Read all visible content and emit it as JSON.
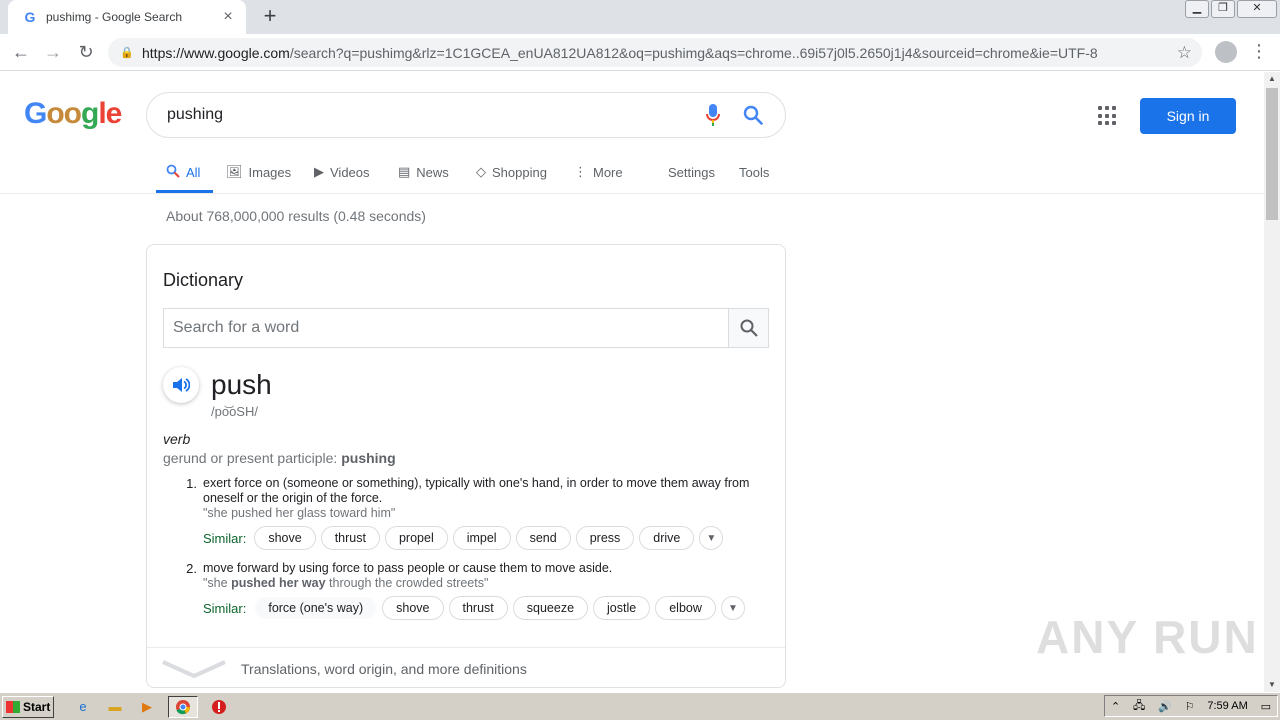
{
  "browser": {
    "tab_title": "pushimg - Google Search",
    "url_host": "https://www.google.com",
    "url_rest": "/search?q=pushimg&rlz=1C1GCEA_enUA812UA812&oq=pushimg&aqs=chrome..69i57j0l5.2650j1j4&sourceid=chrome&ie=UTF-8"
  },
  "search": {
    "query": "pushing"
  },
  "header": {
    "sign_in": "Sign in"
  },
  "tabs": [
    {
      "label": "All"
    },
    {
      "label": "Images"
    },
    {
      "label": "Videos"
    },
    {
      "label": "News"
    },
    {
      "label": "Shopping"
    },
    {
      "label": "More"
    },
    {
      "label": "Settings"
    },
    {
      "label": "Tools"
    }
  ],
  "stats": "About 768,000,000 results (0.48 seconds)",
  "dictionary": {
    "heading": "Dictionary",
    "search_placeholder": "Search for a word",
    "word": "push",
    "phonetic": "/po͝oSH/",
    "part_of_speech": "verb",
    "gerund_label": "gerund or present participle: ",
    "gerund_value": "pushing",
    "similar_label": "Similar:",
    "definitions": [
      {
        "num": "1.",
        "text": "exert force on (someone or something), typically with one's hand, in order to move them away from oneself or the origin of the force.",
        "example": "\"she pushed her glass toward him\"",
        "similar": [
          "shove",
          "thrust",
          "propel",
          "impel",
          "send",
          "press",
          "drive"
        ]
      },
      {
        "num": "2.",
        "text": "move forward by using force to pass people or cause them to move aside.",
        "example_pre": "\"she ",
        "example_bold": "pushed her way",
        "example_post": " through the crowded streets\"",
        "similar_plain": "force (one's way)",
        "similar": [
          "shove",
          "thrust",
          "squeeze",
          "jostle",
          "elbow"
        ]
      }
    ],
    "more_text": "Translations, word origin, and more definitions"
  },
  "watermark": "ANY RUN",
  "taskbar": {
    "start": "Start",
    "clock": "7:59 AM"
  },
  "colors": {
    "accent": "#1a73e8",
    "similar_label": "#0d652d"
  }
}
